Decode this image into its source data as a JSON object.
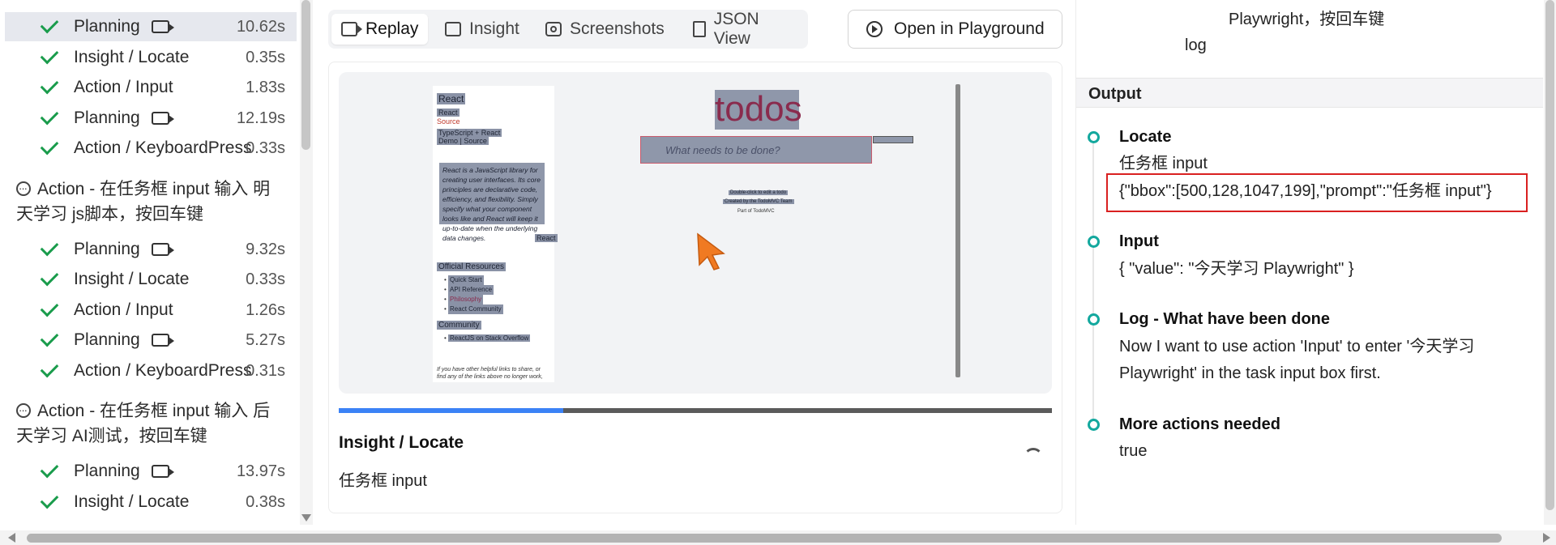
{
  "sidebar": {
    "rows": [
      {
        "label": "Planning",
        "time": "10.62s",
        "video": true
      },
      {
        "label": "Insight / Locate",
        "time": "0.35s",
        "video": false
      },
      {
        "label": "Action / Input",
        "time": "1.83s",
        "video": false
      },
      {
        "label": "Planning",
        "time": "12.19s",
        "video": true
      },
      {
        "label": "Action / KeyboardPress",
        "time": "0.33s",
        "video": false
      },
      {
        "label": "Planning",
        "time": "9.32s",
        "video": true
      },
      {
        "label": "Insight / Locate",
        "time": "0.33s",
        "video": false
      },
      {
        "label": "Action / Input",
        "time": "1.26s",
        "video": false
      },
      {
        "label": "Planning",
        "time": "5.27s",
        "video": true
      },
      {
        "label": "Action / KeyboardPress",
        "time": "0.31s",
        "video": false
      },
      {
        "label": "Planning",
        "time": "13.97s",
        "video": true
      },
      {
        "label": "Insight / Locate",
        "time": "0.38s",
        "video": false
      }
    ],
    "groups": [
      {
        "line1": "Action - 在任务框 input 输入 明",
        "line2": "天学习 js脚本，按回车键"
      },
      {
        "line1": "Action - 在任务框 input 输入 后",
        "line2": "天学习 AI测试，按回车键"
      }
    ]
  },
  "tabs": {
    "replay": "Replay",
    "insight": "Insight",
    "screenshots": "Screenshots",
    "json": "JSON View",
    "playground": "Open in Playground"
  },
  "screenshot": {
    "react_title": "React",
    "react_sub": "React",
    "source": "Source",
    "ts_react": "TypeScript + React",
    "demo_source": "Demo | Source",
    "quote": "React is a JavaScript library for creating user interfaces. Its core principles are declarative code, efficiency, and flexibility. Simply specify what your component looks like and React will keep it up-to-date when the underlying data changes.",
    "react_link": "React",
    "official": "Official Resources",
    "links": [
      "Quick Start",
      "API Reference",
      "Philosophy",
      "React Community"
    ],
    "community": "Community",
    "community_link": "ReactJS on Stack Overflow",
    "footer_note": "If you have other helpful links to share, or find any of the links above no longer work,",
    "todos": "todos",
    "placeholder": "What needs to be done?",
    "foot1": "Double-click to edit a todo",
    "foot2": "Created by the TodoMVC Team",
    "foot3": "Part of TodoMVC"
  },
  "player": {
    "progress": 0.315,
    "step_title": "Insight / Locate",
    "step_desc": "任务框 input"
  },
  "right": {
    "top_line1": "Playwright，按回车键",
    "top_line2": "log",
    "output_header": "Output",
    "items": [
      {
        "label": "Locate",
        "lines": [
          "任务框 input",
          "{\"bbox\":[500,128,1047,199],\"prompt\":\"任务框 input\"}"
        ]
      },
      {
        "label": "Input",
        "lines": [
          "{ \"value\": \"今天学习 Playwright\" }"
        ]
      },
      {
        "label": "Log - What have been done",
        "lines": [
          "Now I want to use action 'Input' to enter '今天学习 Playwright' in the task input box first."
        ]
      },
      {
        "label": "More actions needed",
        "lines": [
          "true"
        ]
      }
    ]
  }
}
